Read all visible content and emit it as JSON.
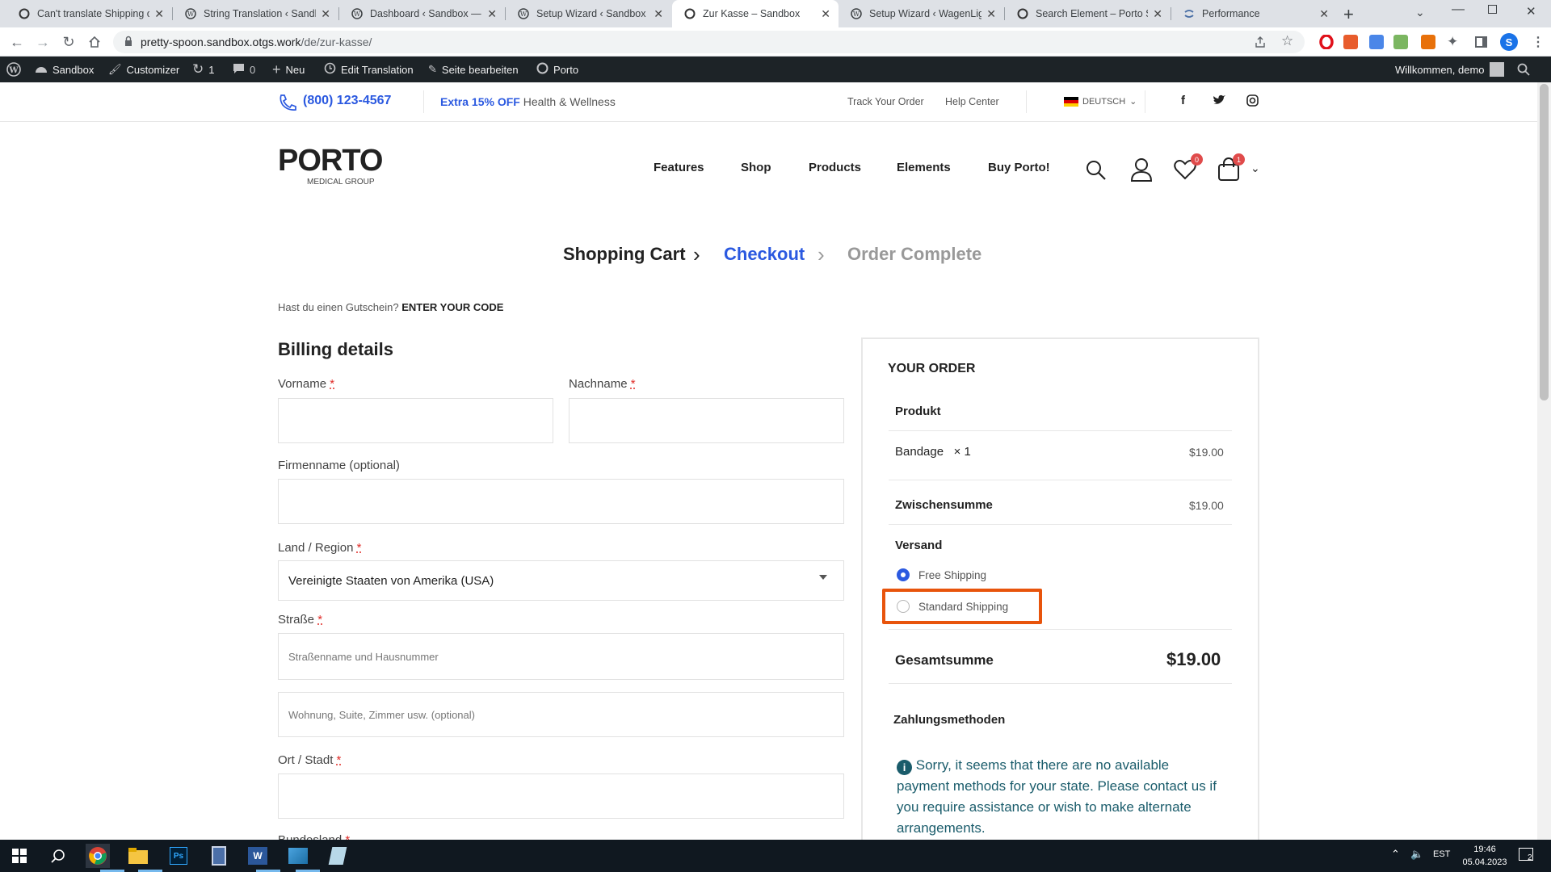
{
  "browser": {
    "tabs": [
      {
        "title": "Can't translate Shipping op",
        "icon": "porto-icon"
      },
      {
        "title": "String Translation ‹ Sandbo",
        "icon": "wordpress-icon"
      },
      {
        "title": "Dashboard ‹ Sandbox — W",
        "icon": "wordpress-icon"
      },
      {
        "title": "Setup Wizard ‹ Sandbox —",
        "icon": "wordpress-icon"
      },
      {
        "title": "Zur Kasse – Sandbox",
        "icon": "porto-icon",
        "active": true
      },
      {
        "title": "Setup Wizard ‹ WagenLigh",
        "icon": "wordpress-icon"
      },
      {
        "title": "Search Element – Porto Sh",
        "icon": "porto-icon"
      },
      {
        "title": "Performance",
        "icon": "wpml-icon"
      }
    ],
    "url_host": "pretty-spoon.sandbox.otgs.work",
    "url_path": "/de/zur-kasse/",
    "profile_initial": "S"
  },
  "wp_admin": {
    "site": "Sandbox",
    "customizer": "Customizer",
    "updates": "1",
    "comments": "0",
    "new": "Neu",
    "edit_translation": "Edit Translation",
    "edit_page": "Seite bearbeiten",
    "porto": "Porto",
    "greeting": "Willkommen, demo"
  },
  "topbar": {
    "phone": "(800) 123-4567",
    "promo_bold": "Extra 15% OFF",
    "promo_text": "Health & Wellness",
    "track": "Track Your Order",
    "help": "Help Center",
    "language": "DEUTSCH"
  },
  "header": {
    "logo": "PORTO",
    "logo_sub": "MEDICAL GROUP",
    "nav": [
      "Features",
      "Shop",
      "Products",
      "Elements",
      "Buy Porto!"
    ],
    "wishlist_count": "0",
    "cart_count": "1"
  },
  "steps": {
    "cart": "Shopping Cart",
    "checkout": "Checkout",
    "complete": "Order Complete"
  },
  "coupon": {
    "question": "Hast du einen Gutschein?",
    "link": "ENTER YOUR CODE"
  },
  "billing": {
    "title": "Billing details",
    "first_name": "Vorname",
    "last_name": "Nachname",
    "company": "Firmenname (optional)",
    "country_label": "Land / Region",
    "country_value": "Vereinigte Staaten von Amerika (USA)",
    "street_label": "Straße",
    "street_placeholder": "Straßenname und Hausnummer",
    "street2_placeholder": "Wohnung, Suite, Zimmer usw. (optional)",
    "city_label": "Ort / Stadt",
    "state_label": "Bundesland",
    "required_mark": "*"
  },
  "order": {
    "title": "YOUR ORDER",
    "product_header": "Produkt",
    "product_name": "Bandage",
    "product_qty": "× 1",
    "product_price": "$19.00",
    "subtotal_label": "Zwischensumme",
    "subtotal_value": "$19.00",
    "shipping_label": "Versand",
    "shipping_options": [
      "Free Shipping",
      "Standard Shipping"
    ],
    "total_label": "Gesamtsumme",
    "total_value": "$19.00",
    "payment_label": "Zahlungsmethoden",
    "payment_notice": "Sorry, it seems that there are no available payment methods for your state. Please contact us if you require assistance or wish to make alternate arrangements."
  },
  "taskbar": {
    "lang": "EST",
    "time": "19:46",
    "date": "05.04.2023",
    "notifications": "2"
  },
  "colors": {
    "accent": "#2b59e0",
    "highlight": "#e8540c",
    "wpbar": "#1d2327",
    "notice": "#1a5c6b"
  }
}
